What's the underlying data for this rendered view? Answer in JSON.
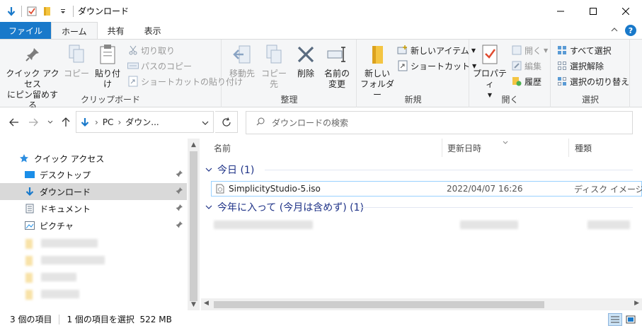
{
  "window": {
    "title": "ダウンロード",
    "minimize_icon": "minimize-icon",
    "maximize_icon": "maximize-icon",
    "close_icon": "close-icon"
  },
  "ribbon_tabs": [
    {
      "label": "ファイル"
    },
    {
      "label": "ホーム"
    },
    {
      "label": "共有"
    },
    {
      "label": "表示"
    }
  ],
  "ribbon": {
    "clipboard": {
      "label": "クリップボード",
      "pin_quick_access_line1": "クイック アクセス",
      "pin_quick_access_line2": "にピン留めする",
      "copy": "コピー",
      "paste": "貼り付け",
      "cut": "切り取り",
      "copy_path": "パスのコピー",
      "paste_shortcut": "ショートカットの貼り付け"
    },
    "organize": {
      "label": "整理",
      "move_to": "移動先",
      "copy_to": "コピー先",
      "delete": "削除",
      "rename_line1": "名前の",
      "rename_line2": "変更"
    },
    "new": {
      "label": "新規",
      "new_folder_line1": "新しい",
      "new_folder_line2": "フォルダー",
      "new_item": "新しいアイテム",
      "shortcut": "ショートカット"
    },
    "open": {
      "label": "開く",
      "properties": "プロパティ",
      "open": "開く",
      "edit": "編集",
      "history": "履歴"
    },
    "select": {
      "label": "選択",
      "select_all": "すべて選択",
      "select_none": "選択解除",
      "invert": "選択の切り替え"
    }
  },
  "address": {
    "crumb_pc": "PC",
    "crumb_current": "ダウン...",
    "search_placeholder": "ダウンロードの検索"
  },
  "nav_pane": {
    "quick_access": "クイック アクセス",
    "items": [
      {
        "label": "デスクトップ"
      },
      {
        "label": "ダウンロード"
      },
      {
        "label": "ドキュメント"
      },
      {
        "label": "ピクチャ"
      }
    ]
  },
  "columns": {
    "name": "名前",
    "date_modified": "更新日時",
    "type": "種類"
  },
  "groups": {
    "today": "今日 (1)",
    "this_year": "今年に入って (今月は含めず) (1)"
  },
  "files": [
    {
      "name": "SimplicityStudio-5.iso",
      "date": "2022/04/07 16:26",
      "type": "ディスク イメージ ファイ"
    }
  ],
  "status": {
    "item_count": "3 個の項目",
    "selection": "1 個の項目を選択  522 MB"
  },
  "colors": {
    "accent": "#1979ca",
    "group_header": "#1e3287",
    "folder": "#f4c542",
    "selection": "#cce8ff"
  }
}
